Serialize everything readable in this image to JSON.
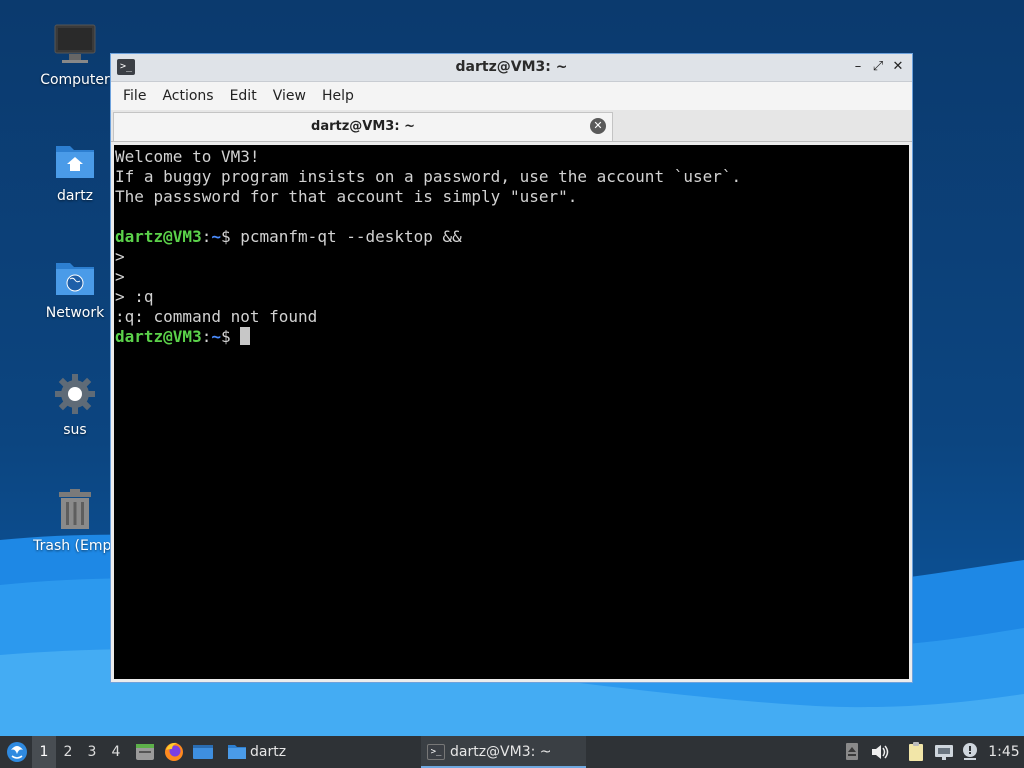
{
  "desktop": {
    "icons": [
      {
        "label": "Computer",
        "icon": "computer-icon"
      },
      {
        "label": "dartz",
        "icon": "home-folder-icon"
      },
      {
        "label": "Network",
        "icon": "network-folder-icon"
      },
      {
        "label": "sus",
        "icon": "gear-icon"
      },
      {
        "label": "Trash (Empt",
        "icon": "trash-icon"
      }
    ]
  },
  "window": {
    "title": "dartz@VM3: ~",
    "controls": {
      "minimize": "–",
      "maximize": "⤢",
      "close": "✕"
    },
    "menu": [
      "File",
      "Actions",
      "Edit",
      "View",
      "Help"
    ],
    "tab": {
      "label": "dartz@VM3: ~",
      "close": "✕"
    }
  },
  "terminal": {
    "welcome": [
      "Welcome to VM3!",
      "If a buggy program insists on a password, use the account `user`.",
      "The passsword for that account is simply \"user\"."
    ],
    "prompt_user": "dartz@VM3",
    "prompt_sep": ":",
    "prompt_path": "~",
    "prompt_dollar": "$ ",
    "command1": "pcmanfm-qt --desktop &&",
    "cont1": ">",
    "cont2": ">",
    "cont3": "> :q",
    "error": ":q: command not found"
  },
  "taskbar": {
    "workspaces": [
      "1",
      "2",
      "3",
      "4"
    ],
    "active_workspace": "1",
    "launchers": [
      "file-manager-icon",
      "firefox-icon",
      "show-desktop-icon"
    ],
    "folder_task": "dartz",
    "active_task": "dartz@VM3: ~",
    "clock": "1:45",
    "tray": [
      "eject-icon",
      "volume-icon",
      "clipboard-icon",
      "network-icon",
      "notification-icon"
    ]
  },
  "colors": {
    "prompt_user": "#5bd24a",
    "prompt_path": "#4a8cff",
    "window_border": "#6da2dd",
    "taskbar": "#2e3236"
  }
}
